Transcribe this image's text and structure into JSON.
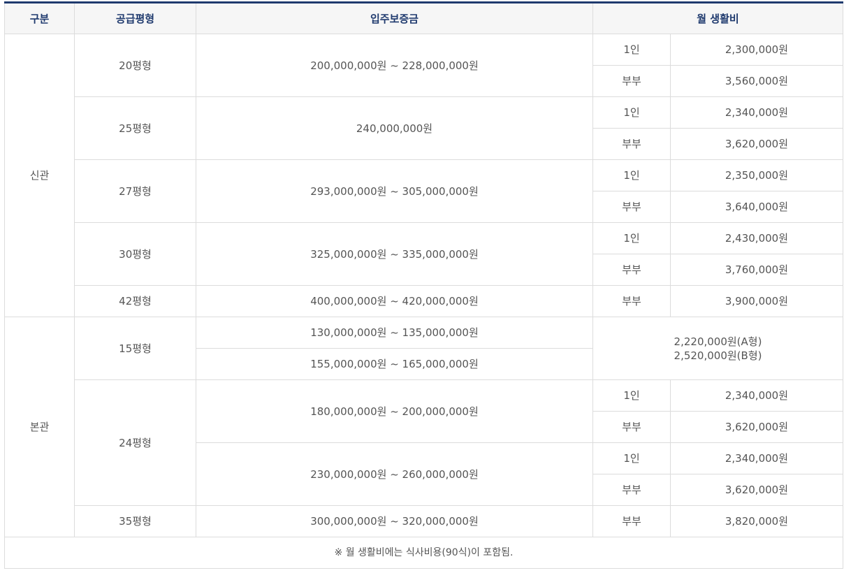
{
  "headers": {
    "category": "구분",
    "size": "공급평형",
    "deposit": "입주보증금",
    "monthly": "월 생활비"
  },
  "labels": {
    "single": "1인",
    "couple": "부부"
  },
  "sections": {
    "new": "신관",
    "main": "본관"
  },
  "rows": {
    "r20": {
      "size": "20평형",
      "deposit": "200,000,000원 ~ 228,000,000원",
      "single": "2,300,000원",
      "couple": "3,560,000원"
    },
    "r25": {
      "size": "25평형",
      "deposit": "240,000,000원",
      "single": "2,340,000원",
      "couple": "3,620,000원"
    },
    "r27": {
      "size": "27평형",
      "deposit": "293,000,000원 ~ 305,000,000원",
      "single": "2,350,000원",
      "couple": "3,640,000원"
    },
    "r30": {
      "size": "30평형",
      "deposit": "325,000,000원 ~ 335,000,000원",
      "single": "2,430,000원",
      "couple": "3,760,000원"
    },
    "r42": {
      "size": "42평형",
      "deposit": "400,000,000원 ~ 420,000,000원",
      "couple": "3,900,000원"
    },
    "r15": {
      "size": "15평형",
      "deposit_a": "130,000,000원 ~ 135,000,000원",
      "deposit_b": "155,000,000원 ~ 165,000,000원",
      "monthly_a": "2,220,000원(A형)",
      "monthly_b": "2,520,000원(B형)"
    },
    "r24": {
      "size": "24평형",
      "deposit_a": "180,000,000원 ~ 200,000,000원",
      "single_a": "2,340,000원",
      "couple_a": "3,620,000원",
      "deposit_b": "230,000,000원 ~ 260,000,000원",
      "single_b": "2,340,000원",
      "couple_b": "3,620,000원"
    },
    "r35": {
      "size": "35평형",
      "deposit": "300,000,000원 ~ 320,000,000원",
      "couple": "3,820,000원"
    }
  },
  "note": "※ 월 생활비에는 식사비용(90식)이 포함됨."
}
